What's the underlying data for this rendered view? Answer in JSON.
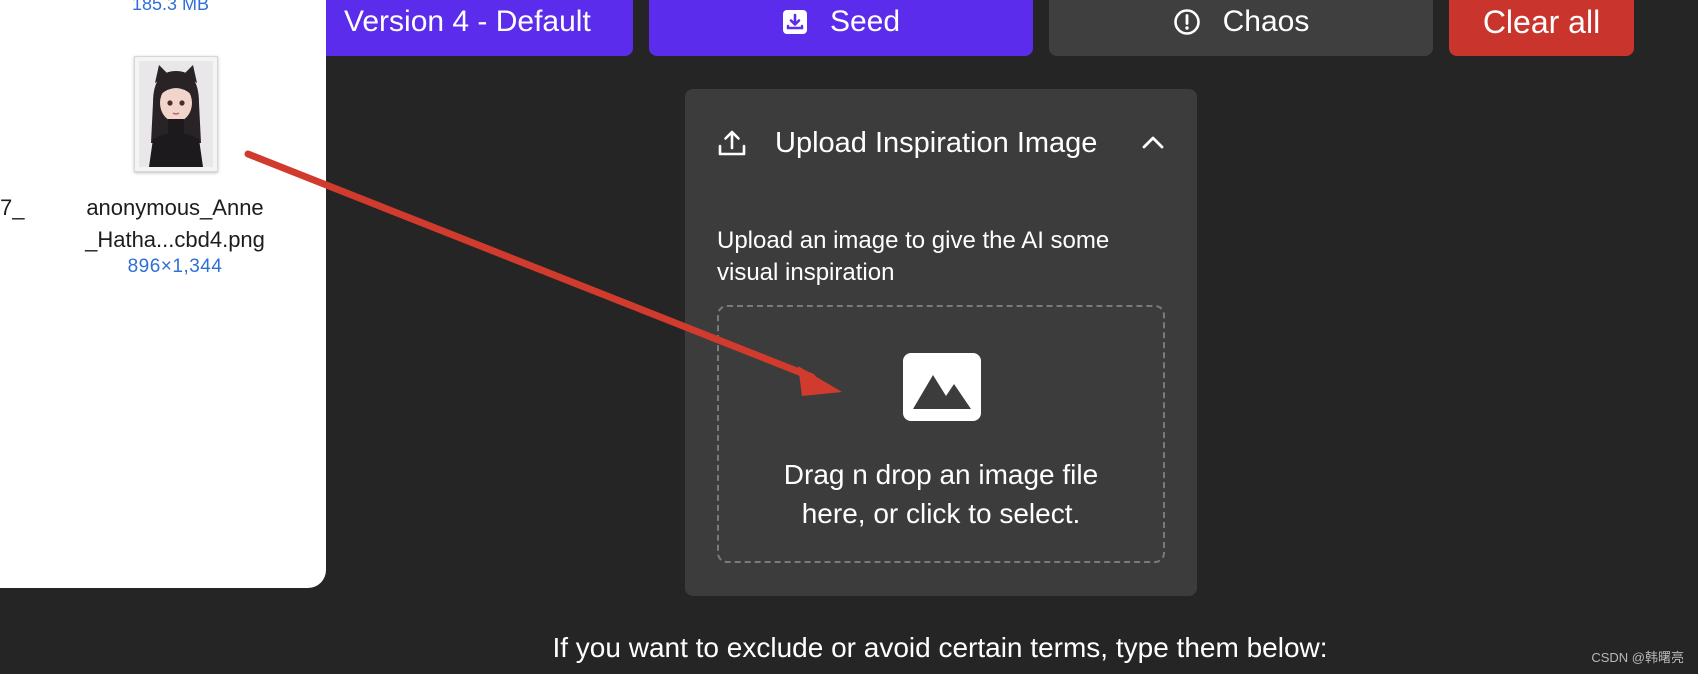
{
  "toolbar": {
    "version_label": "Version 4 - Default",
    "seed_label": "Seed",
    "chaos_label": "Chaos",
    "clear_label": "Clear all"
  },
  "finder": {
    "file_size_top": "185.3 MB",
    "left_fragment": "7_",
    "file_name_line1": "anonymous_Anne",
    "file_name_line2": "_Hatha...cbd4.png",
    "file_dims": "896×1,344"
  },
  "upload": {
    "title": "Upload Inspiration Image",
    "description": "Upload an image to give the AI some visual inspiration",
    "drop_line1": "Drag n drop an image file",
    "drop_line2": "here, or click to select."
  },
  "exclude_prompt": "If you want to exclude or avoid certain terms, type them below:",
  "watermark": "CSDN @韩曙亮",
  "colors": {
    "background": "#252525",
    "card": "#3c3c3c",
    "primary_purple": "#5b2cec",
    "secondary_gray": "#3f3f3f",
    "danger_red": "#c9352d",
    "arrow_red": "#d13b2e",
    "link_blue": "#2f6fd6"
  },
  "icons": [
    "seed-download-icon",
    "chaos-info-icon",
    "upload-icon",
    "chevron-up-icon",
    "image-placeholder-icon"
  ]
}
